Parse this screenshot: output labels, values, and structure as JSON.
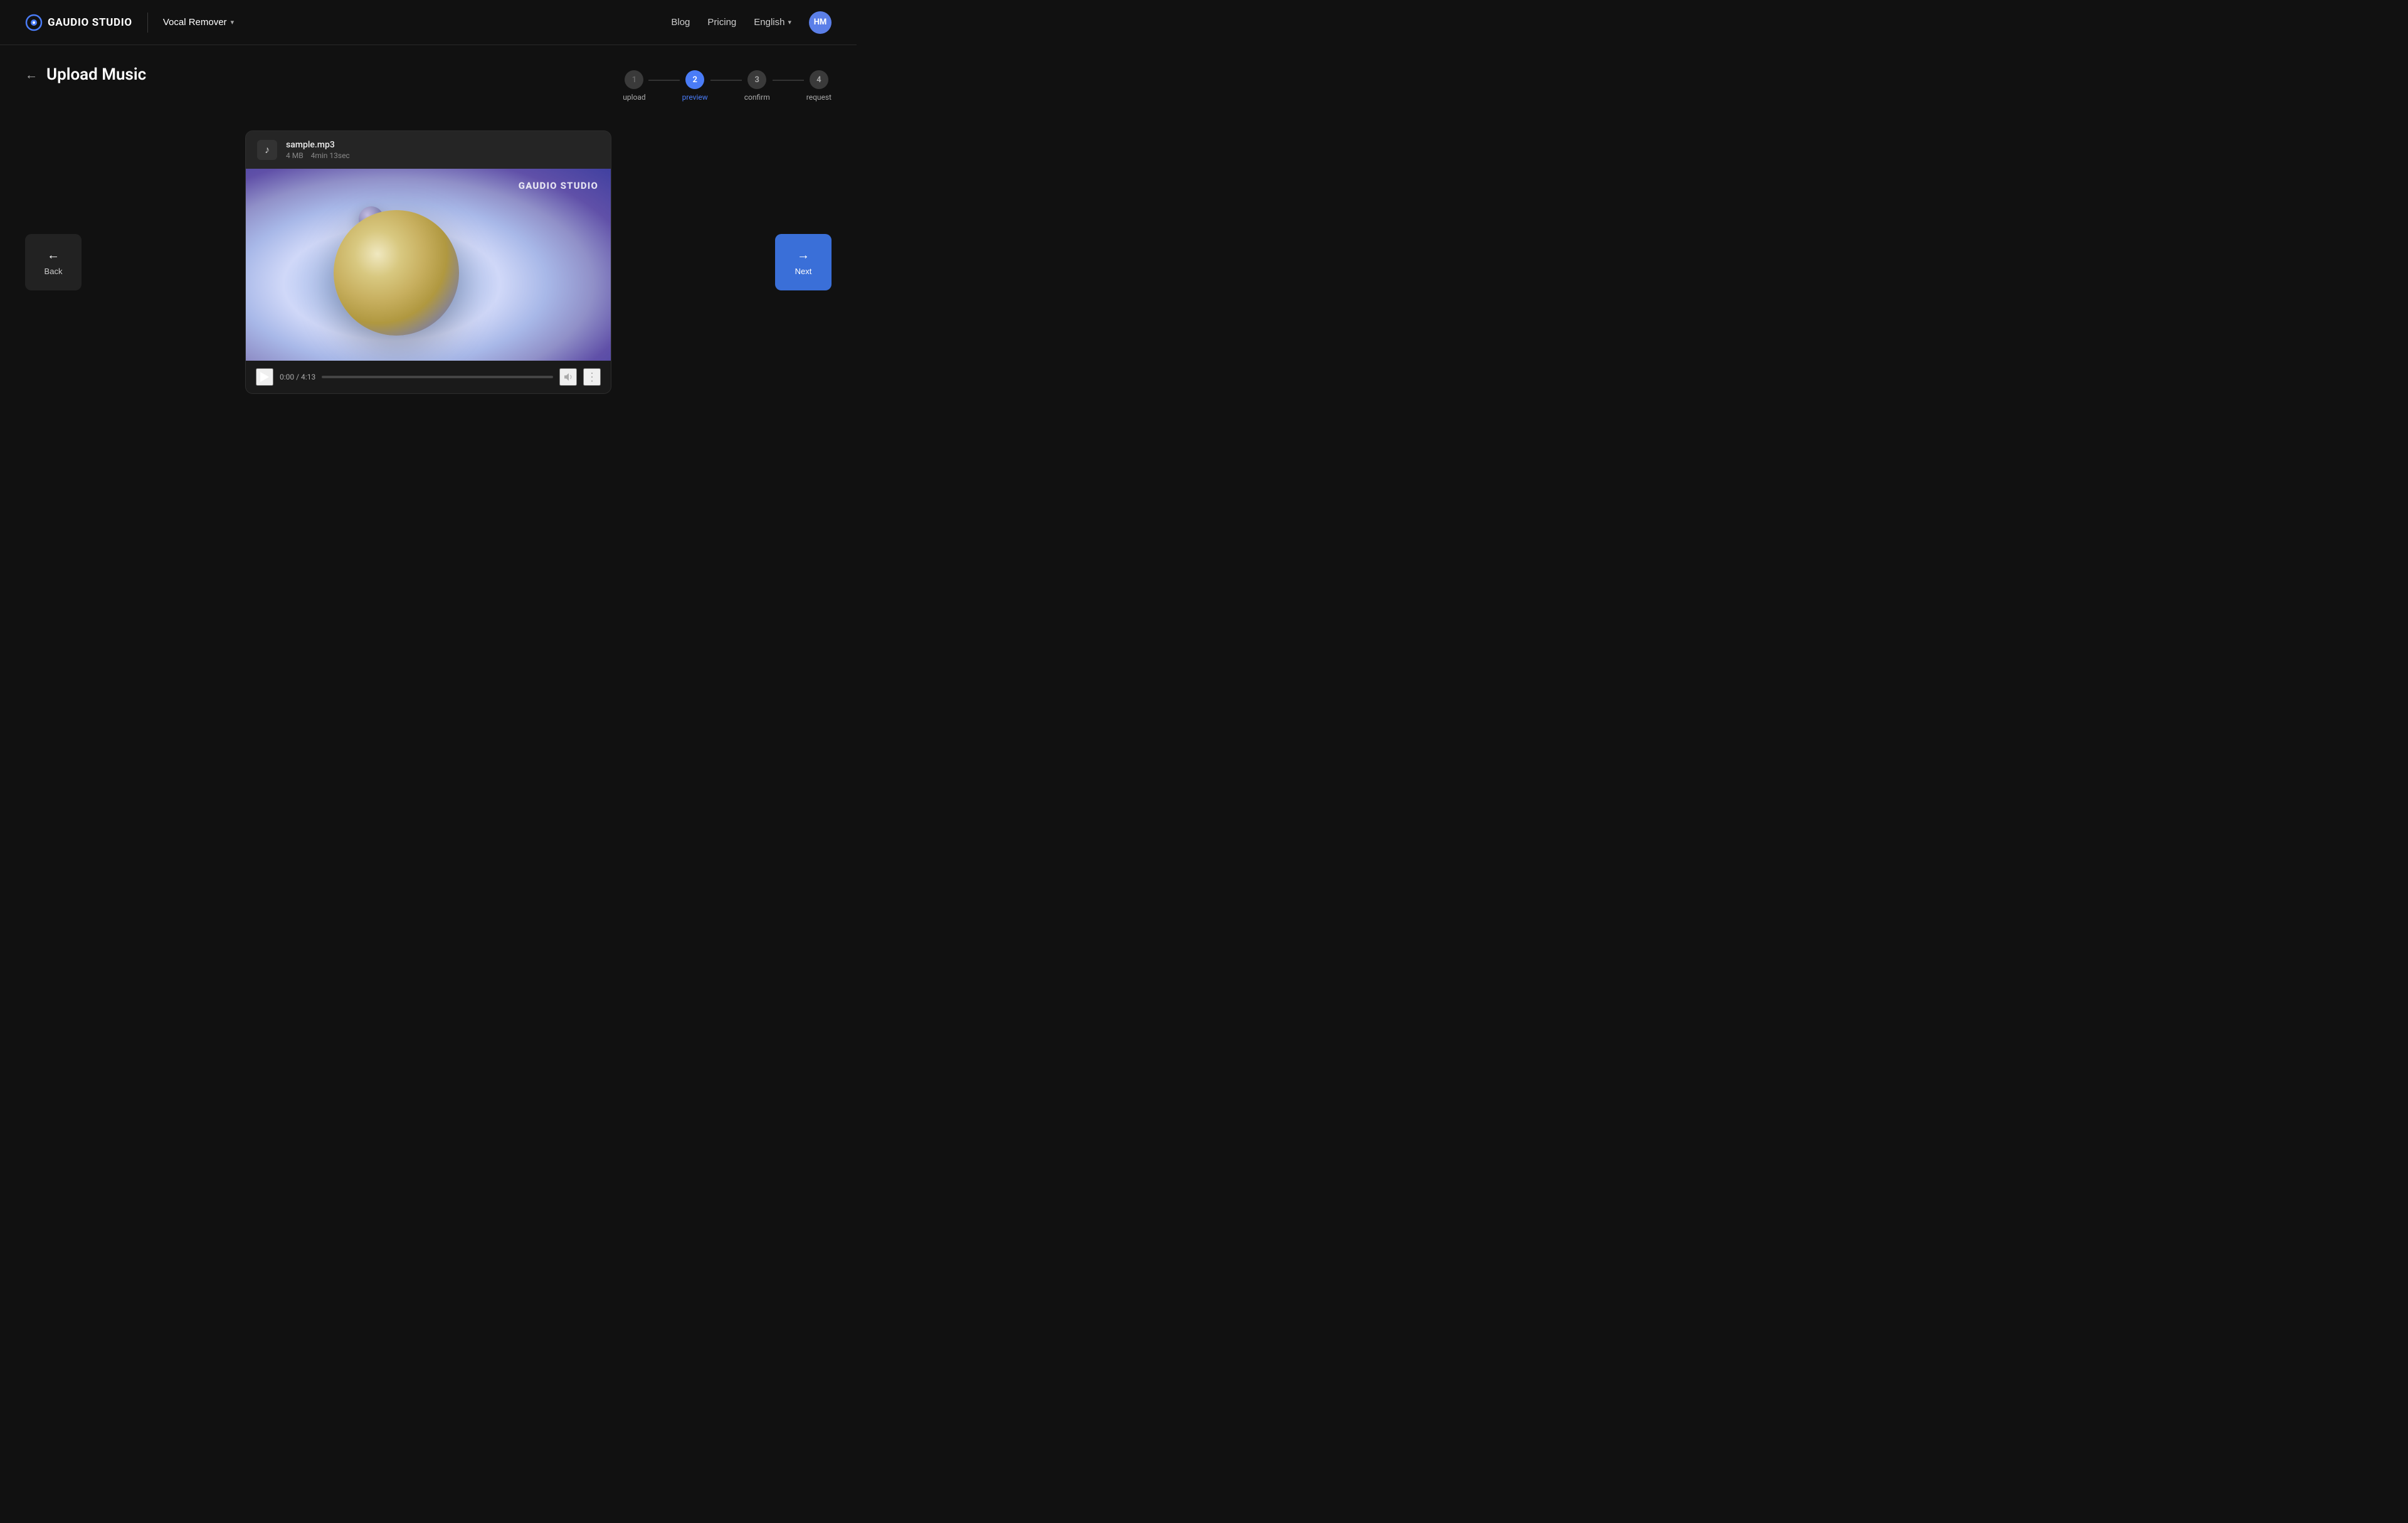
{
  "header": {
    "logo_text": "GAUDIO STUDIO",
    "tool_name": "Vocal Remover",
    "nav": {
      "blog": "Blog",
      "pricing": "Pricing",
      "language": "English",
      "avatar_initials": "HM"
    }
  },
  "page": {
    "back_arrow": "←",
    "title": "Upload Music"
  },
  "stepper": {
    "steps": [
      {
        "number": "1",
        "label": "upload",
        "state": "done"
      },
      {
        "number": "2",
        "label": "preview",
        "state": "active"
      },
      {
        "number": "3",
        "label": "confirm",
        "state": "default"
      },
      {
        "number": "4",
        "label": "request",
        "state": "default"
      }
    ]
  },
  "media_player": {
    "file_name": "sample.mp3",
    "file_size": "4 MB",
    "file_duration": "4min 13sec",
    "thumbnail_watermark": "GAUDIO STUDIO",
    "time_display": "0:00 / 4:13",
    "progress_pct": 0
  },
  "controls": {
    "back_label": "Back",
    "next_label": "Next"
  }
}
